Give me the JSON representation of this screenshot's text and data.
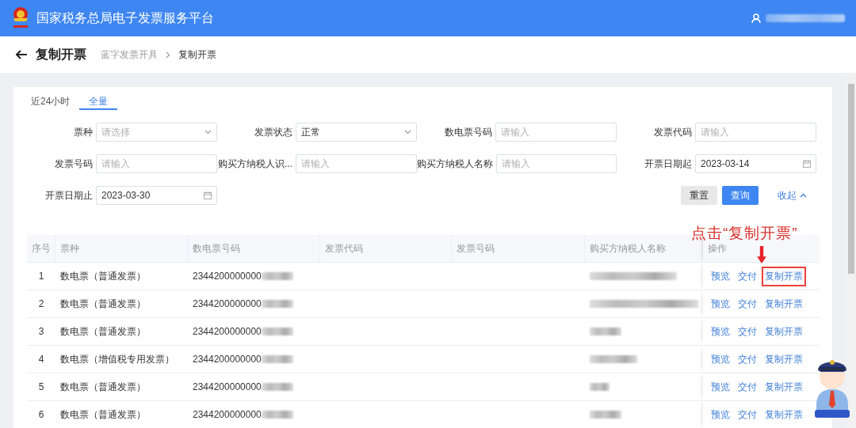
{
  "header": {
    "title": "国家税务总局电子发票服务平台"
  },
  "page": {
    "title": "复制开票",
    "breadcrumb": [
      "蓝字发票开具",
      "复制开票"
    ]
  },
  "tabs": [
    {
      "label": "近24小时",
      "selected": false
    },
    {
      "label": "全量",
      "selected": true
    }
  ],
  "filters": [
    {
      "label": "票种",
      "kind": "select",
      "placeholder": "请选择"
    },
    {
      "label": "发票状态",
      "kind": "select",
      "value": "正常"
    },
    {
      "label": "数电票号码",
      "kind": "text",
      "placeholder": "请输入"
    },
    {
      "label": "发票代码",
      "kind": "text",
      "placeholder": "请输入"
    },
    {
      "label": "发票号码",
      "kind": "text",
      "placeholder": "请输入"
    },
    {
      "label": "购买方纳税人识...",
      "kind": "text",
      "placeholder": "请输入"
    },
    {
      "label": "购买方纳税人名称",
      "kind": "text",
      "placeholder": "请输入"
    },
    {
      "label": "开票日期起",
      "kind": "date",
      "value": "2023-03-14"
    },
    {
      "label": "开票日期止",
      "kind": "date",
      "value": "2023-03-30"
    }
  ],
  "buttons": [
    {
      "label": "重置",
      "kind": "default"
    },
    {
      "label": "查询",
      "kind": "primary"
    },
    {
      "label": "收起",
      "kind": "link"
    }
  ],
  "table": {
    "columns": [
      "序号",
      "票种",
      "数电票号码",
      "发票代码",
      "发票号码",
      "购买方纳税人名称",
      "操作"
    ],
    "rows": [
      {
        "index": "1",
        "type": "数电票（普通发票）",
        "number": "2344200000000",
        "actions": [
          "预览",
          "交付",
          "复制开票"
        ],
        "highlighted": true
      },
      {
        "index": "2",
        "type": "数电票（普通发票）",
        "number": "2344200000000",
        "actions": [
          "预览",
          "交付",
          "复制开票"
        ],
        "highlighted": false
      },
      {
        "index": "3",
        "type": "数电票（普通发票）",
        "number": "2344200000000",
        "actions": [
          "预览",
          "交付",
          "复制开票"
        ],
        "highlighted": false
      },
      {
        "index": "4",
        "type": "数电票（增值税专用发票）",
        "number": "2344200000000",
        "actions": [
          "预览",
          "交付",
          "复制开票"
        ],
        "highlighted": false
      },
      {
        "index": "5",
        "type": "数电票（普通发票）",
        "number": "2344200000000",
        "actions": [
          "预览",
          "交付",
          "复制开票"
        ],
        "highlighted": false
      },
      {
        "index": "6",
        "type": "数电票（普通发票）",
        "number": "2344200000000",
        "actions": [
          "预览",
          "交付",
          "复制开票"
        ],
        "highlighted": false
      }
    ]
  },
  "annotation": {
    "text": "点击“复制开票”"
  }
}
